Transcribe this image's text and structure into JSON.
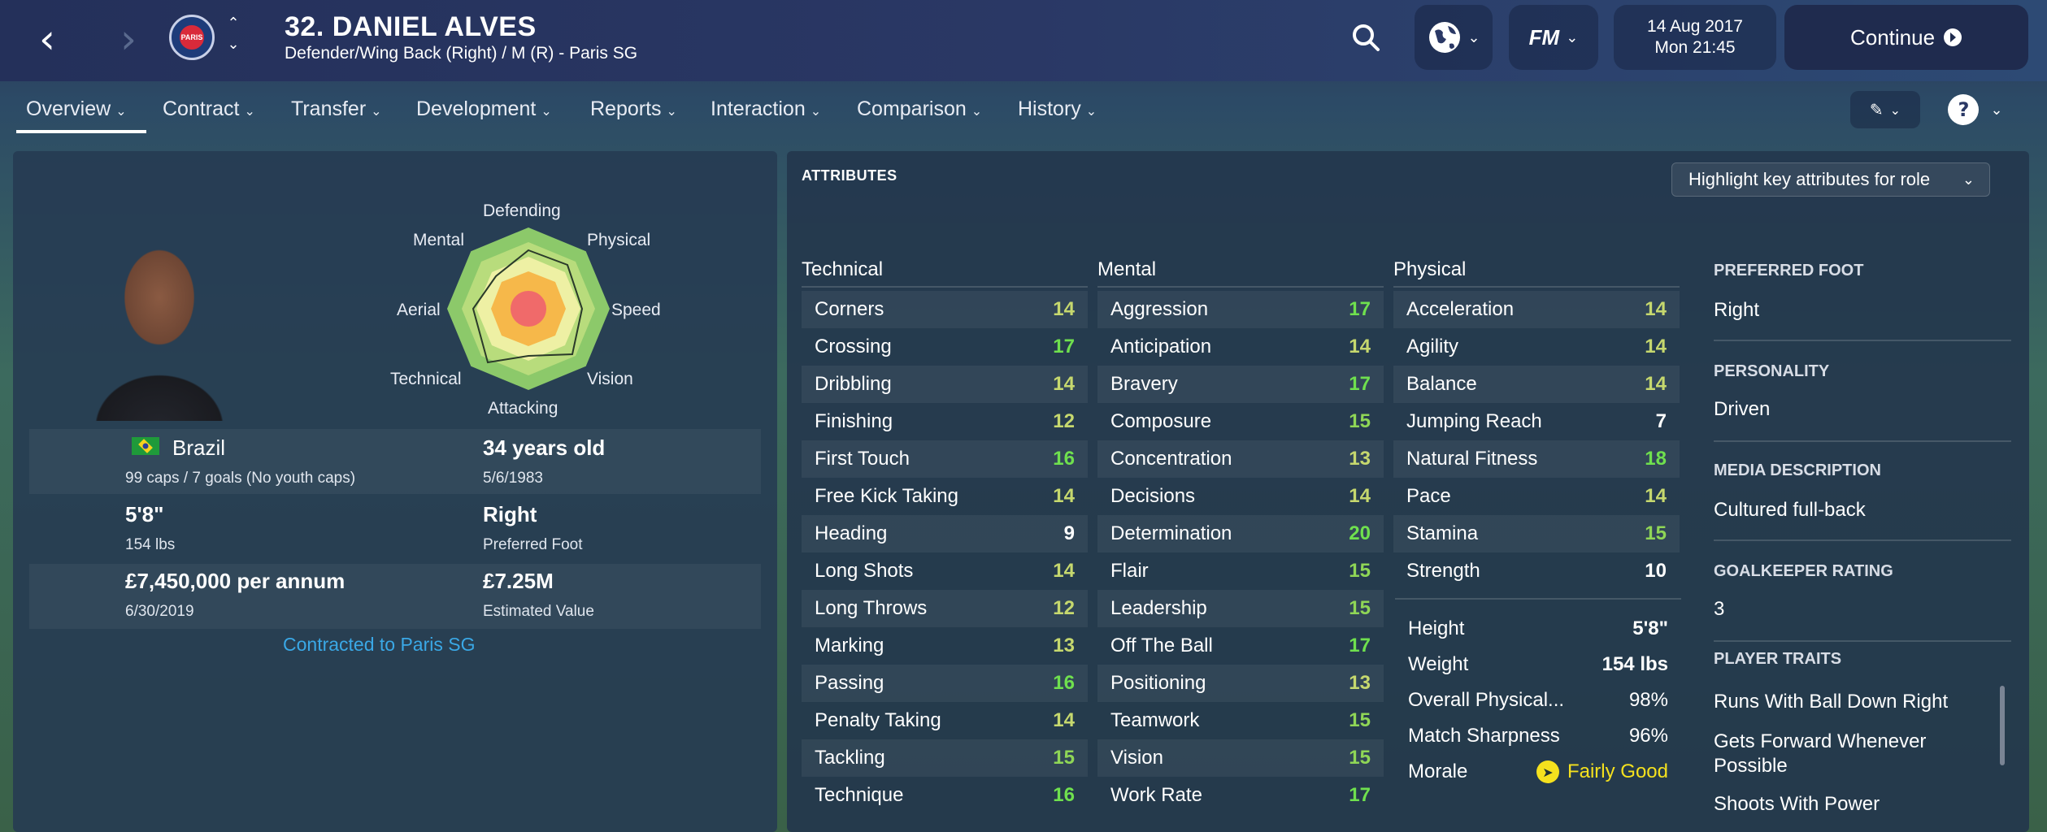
{
  "header": {
    "player_title": "32. DANIEL ALVES",
    "player_subtitle": "Defender/Wing Back (Right) / M (R) - Paris SG",
    "club_badge_text": "PARIS",
    "date": "14 Aug 2017",
    "time": "Mon 21:45",
    "continue_label": "Continue",
    "fm_label": "FM"
  },
  "tabs": [
    {
      "label": "Overview"
    },
    {
      "label": "Contract"
    },
    {
      "label": "Transfer"
    },
    {
      "label": "Development"
    },
    {
      "label": "Reports"
    },
    {
      "label": "Interaction"
    },
    {
      "label": "Comparison"
    },
    {
      "label": "History"
    }
  ],
  "radar": {
    "labels": {
      "defending": "Defending",
      "physical": "Physical",
      "speed": "Speed",
      "vision": "Vision",
      "attacking": "Attacking",
      "technical": "Technical",
      "aerial": "Aerial",
      "mental": "Mental"
    }
  },
  "profile": {
    "nationality": "Brazil",
    "caps": "99 caps / 7 goals (No youth caps)",
    "age": "34 years old",
    "dob": "5/6/1983",
    "height": "5'8\"",
    "weight": "154 lbs",
    "foot": "Right",
    "foot_label": "Preferred Foot",
    "wage": "£7,450,000 per annum",
    "contract_expiry": "6/30/2019",
    "value": "£7.25M",
    "value_label": "Estimated Value",
    "contract_link": "Contracted to Paris SG"
  },
  "attributes": {
    "header": "ATTRIBUTES",
    "highlight_dropdown": "Highlight key attributes for role",
    "technical_label": "Technical",
    "mental_label": "Mental",
    "physical_label": "Physical",
    "technical": [
      {
        "name": "Corners",
        "value": "14"
      },
      {
        "name": "Crossing",
        "value": "17"
      },
      {
        "name": "Dribbling",
        "value": "14"
      },
      {
        "name": "Finishing",
        "value": "12"
      },
      {
        "name": "First Touch",
        "value": "16"
      },
      {
        "name": "Free Kick Taking",
        "value": "14"
      },
      {
        "name": "Heading",
        "value": "9"
      },
      {
        "name": "Long Shots",
        "value": "14"
      },
      {
        "name": "Long Throws",
        "value": "12"
      },
      {
        "name": "Marking",
        "value": "13"
      },
      {
        "name": "Passing",
        "value": "16"
      },
      {
        "name": "Penalty Taking",
        "value": "14"
      },
      {
        "name": "Tackling",
        "value": "15"
      },
      {
        "name": "Technique",
        "value": "16"
      }
    ],
    "mental": [
      {
        "name": "Aggression",
        "value": "17"
      },
      {
        "name": "Anticipation",
        "value": "14"
      },
      {
        "name": "Bravery",
        "value": "17"
      },
      {
        "name": "Composure",
        "value": "15"
      },
      {
        "name": "Concentration",
        "value": "13"
      },
      {
        "name": "Decisions",
        "value": "14"
      },
      {
        "name": "Determination",
        "value": "20"
      },
      {
        "name": "Flair",
        "value": "15"
      },
      {
        "name": "Leadership",
        "value": "15"
      },
      {
        "name": "Off The Ball",
        "value": "17"
      },
      {
        "name": "Positioning",
        "value": "13"
      },
      {
        "name": "Teamwork",
        "value": "15"
      },
      {
        "name": "Vision",
        "value": "15"
      },
      {
        "name": "Work Rate",
        "value": "17"
      }
    ],
    "physical": [
      {
        "name": "Acceleration",
        "value": "14"
      },
      {
        "name": "Agility",
        "value": "14"
      },
      {
        "name": "Balance",
        "value": "14"
      },
      {
        "name": "Jumping Reach",
        "value": "7"
      },
      {
        "name": "Natural Fitness",
        "value": "18"
      },
      {
        "name": "Pace",
        "value": "14"
      },
      {
        "name": "Stamina",
        "value": "15"
      },
      {
        "name": "Strength",
        "value": "10"
      }
    ],
    "physical_extra": [
      {
        "name": "Height",
        "value": "5'8\""
      },
      {
        "name": "Weight",
        "value": "154 lbs"
      },
      {
        "name": "Overall Physical...",
        "value": "98%"
      },
      {
        "name": "Match Sharpness",
        "value": "96%"
      }
    ],
    "morale_label": "Morale",
    "morale_value": "Fairly Good"
  },
  "side": {
    "preferred_foot_label": "PREFERRED FOOT",
    "preferred_foot": "Right",
    "personality_label": "PERSONALITY",
    "personality": "Driven",
    "media_label": "MEDIA DESCRIPTION",
    "media": "Cultured full-back",
    "gk_label": "GOALKEEPER RATING",
    "gk": "3",
    "traits_label": "PLAYER TRAITS",
    "traits": [
      "Runs With Ball Down Right",
      "Gets Forward Whenever Possible",
      "Shoots With Power"
    ]
  }
}
